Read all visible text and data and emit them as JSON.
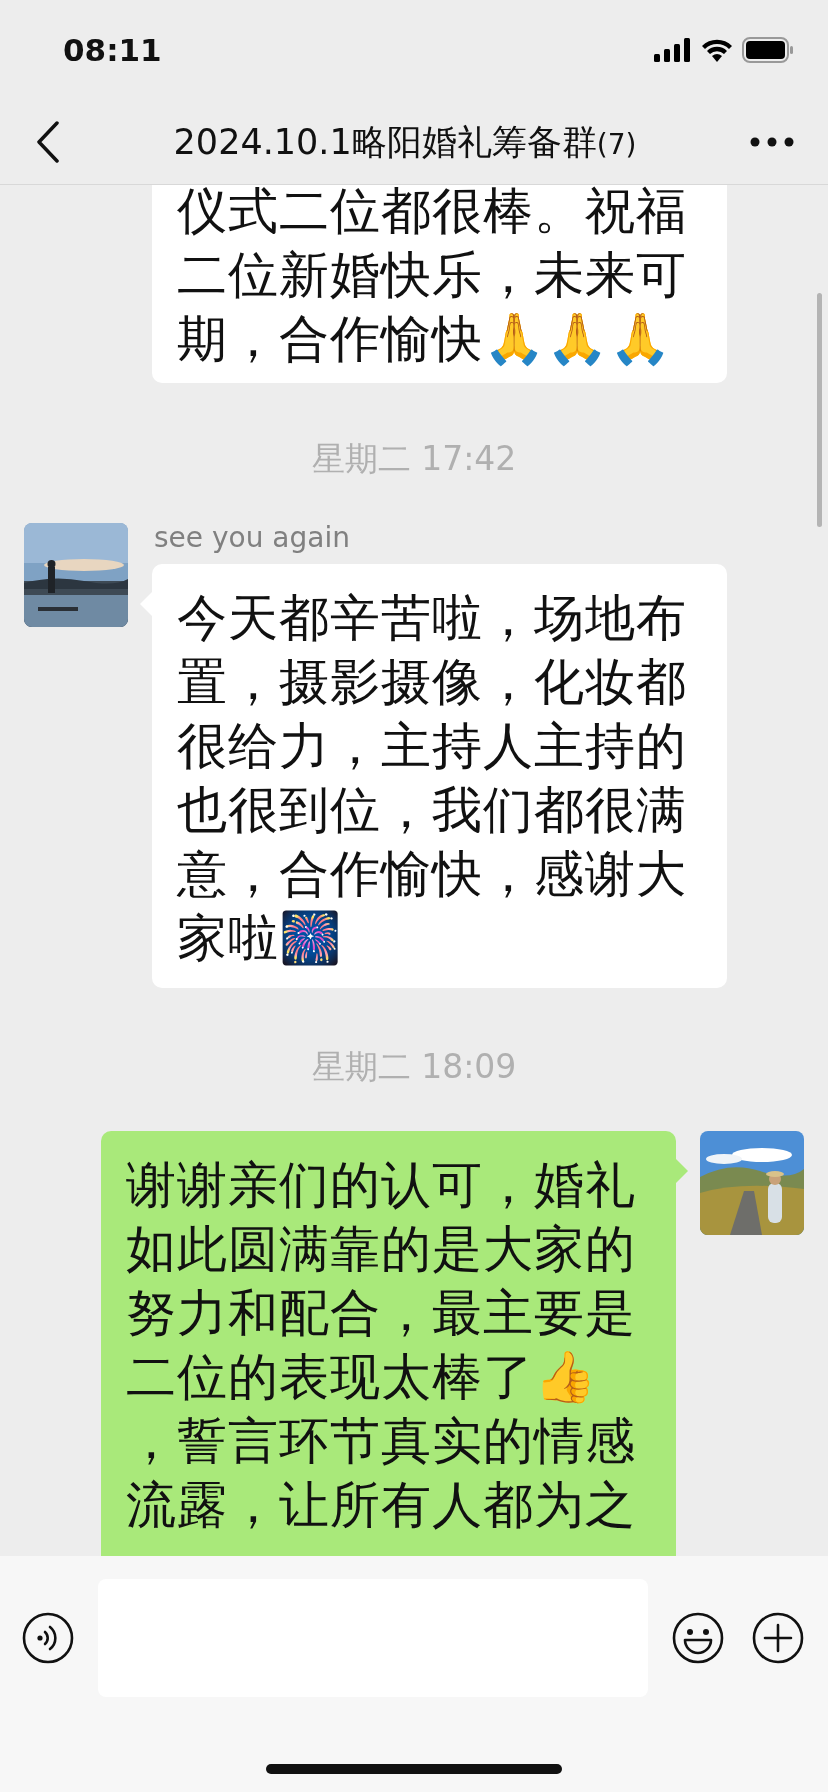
{
  "status_bar": {
    "time": "08:11"
  },
  "header": {
    "title": "2024.10.1略阳婚礼筹备群",
    "member_count": "(7)"
  },
  "items": [
    {
      "kind": "incoming",
      "avatar": false,
      "lines": [
        "仪式二位都很棒。祝福",
        "二位新婚快乐，未来可",
        "期，合作愉快🙏🙏🙏"
      ]
    },
    {
      "kind": "time",
      "text": "星期二 17:42"
    },
    {
      "kind": "incoming",
      "avatar": true,
      "sender": "see you again",
      "lines": [
        "今天都辛苦啦，场地布",
        "置，摄影摄像，化妆都",
        "很给力，主持人主持的",
        "也很到位，我们都很满",
        "意，合作愉快，感谢大",
        "家啦🎆"
      ]
    },
    {
      "kind": "time",
      "text": "星期二 18:09"
    },
    {
      "kind": "outgoing",
      "avatar": true,
      "lines": [
        "谢谢亲们的认可，婚礼",
        "如此圆满靠的是大家的",
        "努力和配合，最主要是",
        "二位的表现太棒了👍",
        "，誓言环节真实的情感",
        "流露，让所有人都为之"
      ]
    }
  ]
}
